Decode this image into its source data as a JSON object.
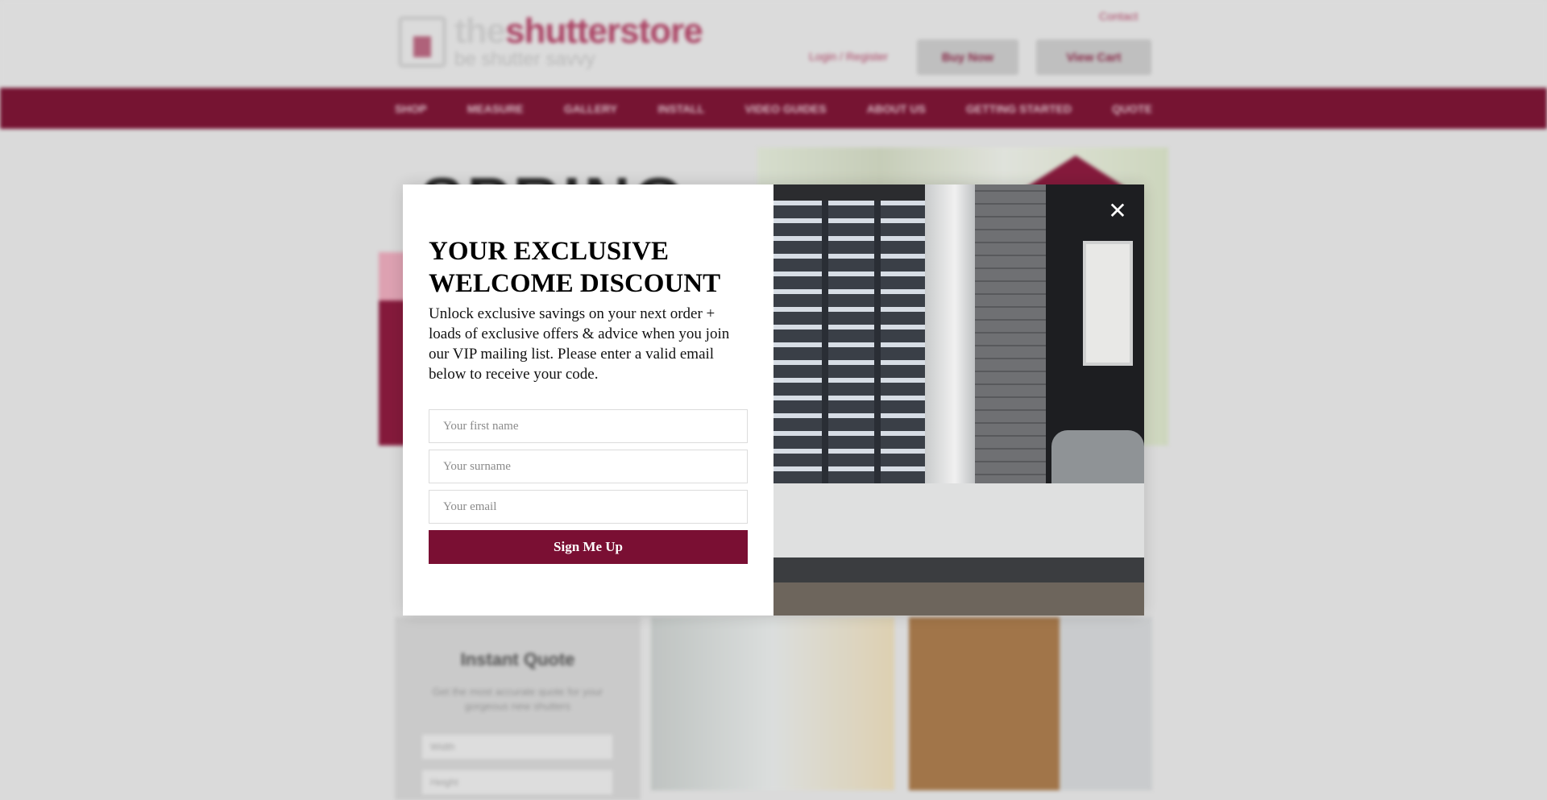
{
  "header": {
    "logo_primary": "the",
    "logo_secondary": "shutterstore",
    "logo_tagline": "be shutter savvy",
    "contact_label": "Contact",
    "login_label": "Login / Register",
    "buy_now_label": "Buy Now",
    "view_cart_label": "View Cart"
  },
  "nav": {
    "items": [
      "SHOP",
      "MEASURE",
      "GALLERY",
      "INSTALL",
      "VIDEO GUIDES",
      "ABOUT US",
      "GETTING STARTED",
      "QUOTE"
    ]
  },
  "banner": {
    "headline": "SPRING"
  },
  "instant_quote": {
    "title": "Instant Quote",
    "description": "Get the most accurate quote for your gorgeous new shutters",
    "width_label": "Width",
    "height_label": "Height"
  },
  "modal": {
    "title": "YOUR EXCLUSIVE WELCOME DISCOUNT",
    "body": "Unlock exclusive savings on your next order + loads of exclusive offers & advice when you join our VIP mailing list. Please enter a valid email below to receive your code.",
    "first_name_placeholder": "Your first name",
    "surname_placeholder": "Your surname",
    "email_placeholder": "Your email",
    "submit_label": "Sign Me Up",
    "close_label": "✕"
  },
  "colors": {
    "brand": "#7a0f33",
    "background": "#e3e3e3"
  }
}
